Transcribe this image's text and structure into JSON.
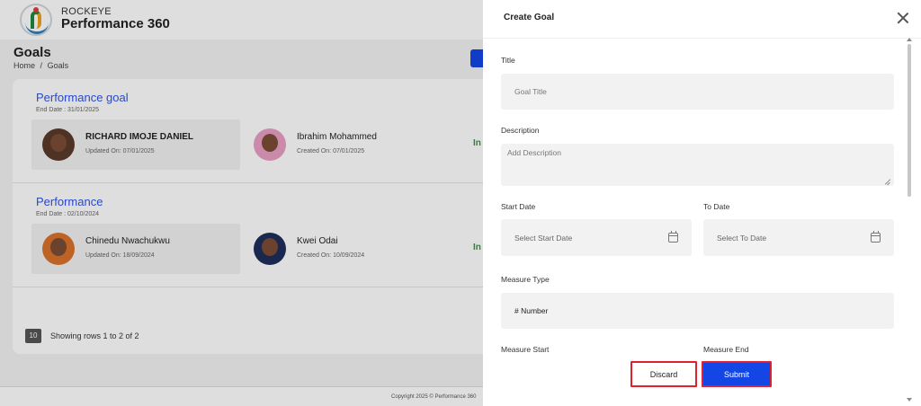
{
  "app": {
    "brand_top": "ROCKEYE",
    "brand_name": "Performance 360"
  },
  "page": {
    "title": "Goals",
    "breadcrumb": [
      "Home",
      "/",
      "Goals"
    ]
  },
  "goals": [
    {
      "title": "Performance goal",
      "end_date": "End Date : 31/01/2025",
      "owner": {
        "name": "RICHARD IMOJE DANIEL",
        "date": "Updated On: 07/01/2025"
      },
      "creator": {
        "name": "Ibrahim Mohammed",
        "date": "Created On: 07/01/2025"
      },
      "status": "In"
    },
    {
      "title": "Performance",
      "end_date": "End Date : 02/10/2024",
      "owner": {
        "name": "Chinedu Nwachukwu",
        "date": "Updated On: 18/09/2024"
      },
      "creator": {
        "name": "Kwei Odai",
        "date": "Created On: 10/09/2024"
      },
      "status": "In"
    }
  ],
  "pagination": {
    "page_size": "10",
    "summary": "Showing rows 1 to 2 of 2"
  },
  "footer": {
    "text": "Copyright 2025 © Performance 360"
  },
  "drawer": {
    "title": "Create Goal",
    "fields": {
      "title_label": "Title",
      "title_placeholder": "Goal Title",
      "description_label": "Description",
      "description_placeholder": "Add Description",
      "start_date_label": "Start Date",
      "start_date_placeholder": "Select Start Date",
      "to_date_label": "To Date",
      "to_date_placeholder": "Select To Date",
      "measure_type_label": "Measure Type",
      "measure_type_value": "# Number",
      "measure_start_label": "Measure Start",
      "measure_end_label": "Measure End"
    },
    "buttons": {
      "discard": "Discard",
      "submit": "Submit"
    }
  },
  "colors": {
    "accent": "#1446e6",
    "link": "#2f54e6",
    "status_green": "#2a9d3a",
    "highlight_border": "#e0202c"
  }
}
